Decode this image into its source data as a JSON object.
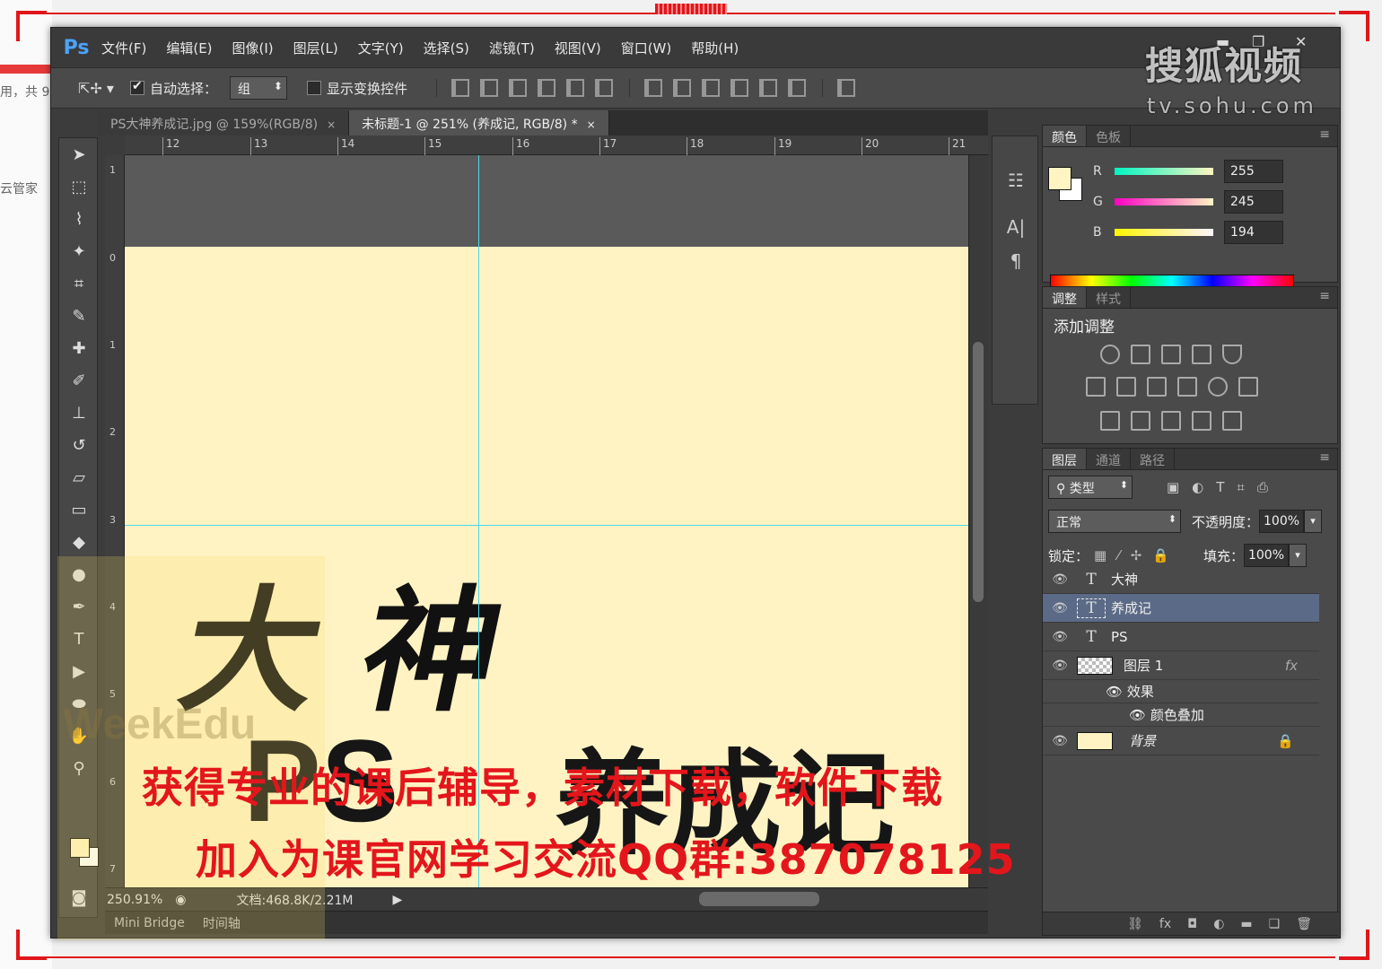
{
  "background": {
    "text1": "用，共 9",
    "text2": "云管家"
  },
  "menubar": {
    "logo": "Ps",
    "items": [
      "文件(F)",
      "编辑(E)",
      "图像(I)",
      "图层(L)",
      "文字(Y)",
      "选择(S)",
      "滤镜(T)",
      "视图(V)",
      "窗口(W)",
      "帮助(H)"
    ]
  },
  "options": {
    "auto_select_label": "自动选择：",
    "auto_select_value": "组",
    "show_transform_label": "显示变换控件"
  },
  "tabs": [
    {
      "label": "PS大神养成记.jpg @ 159%(RGB/8)",
      "close": "×"
    },
    {
      "label": "未标题-1 @ 251% (养成记, RGB/8) *",
      "close": "×"
    }
  ],
  "ruler_h": [
    "12",
    "13",
    "14",
    "15",
    "16",
    "17",
    "18",
    "19",
    "20",
    "21"
  ],
  "ruler_v": [
    "1",
    "0",
    "1",
    "2",
    "3",
    "4",
    "5",
    "6",
    "7"
  ],
  "canvas": {
    "text_dashen": "大神",
    "text_ps": "PS",
    "text_yangchengji": "养成记"
  },
  "status": {
    "zoom": "250.91%",
    "doc": "文档:468.8K/2.21M"
  },
  "bottom_tabs": [
    "Mini Bridge",
    "时间轴"
  ],
  "color_panel": {
    "tabs": [
      "颜色",
      "色板"
    ],
    "r_label": "R",
    "r": "255",
    "g_label": "G",
    "g": "245",
    "b_label": "B",
    "b": "194",
    "fg_color": "#fff5c2"
  },
  "adjust_panel": {
    "tabs": [
      "调整",
      "样式"
    ],
    "title": "添加调整"
  },
  "layers_panel": {
    "tabs": [
      "图层",
      "通道",
      "路径"
    ],
    "filter_label": "类型",
    "blend_mode": "正常",
    "opacity_label": "不透明度：",
    "opacity": "100%",
    "lock_label": "锁定：",
    "fill_label": "填充：",
    "fill": "100%",
    "layers": [
      {
        "name": "大神",
        "kind": "T"
      },
      {
        "name": "养成记",
        "kind": "T"
      },
      {
        "name": "PS",
        "kind": "T"
      },
      {
        "name": "图层 1",
        "kind": "pixel"
      },
      {
        "name": "效果",
        "kind": "effects"
      },
      {
        "name": "颜色叠加",
        "kind": "effect"
      },
      {
        "name": "背景",
        "kind": "background"
      }
    ]
  },
  "overlay": {
    "watermark": "搜狐视频",
    "watermark_url": "tv.sohu.com",
    "promo_line1": "获得专业的课后辅导，素材下载，软件下载",
    "promo_line2": "加入为课官网学习交流QQ群:387078125",
    "logo_text": "WeekEdu"
  }
}
